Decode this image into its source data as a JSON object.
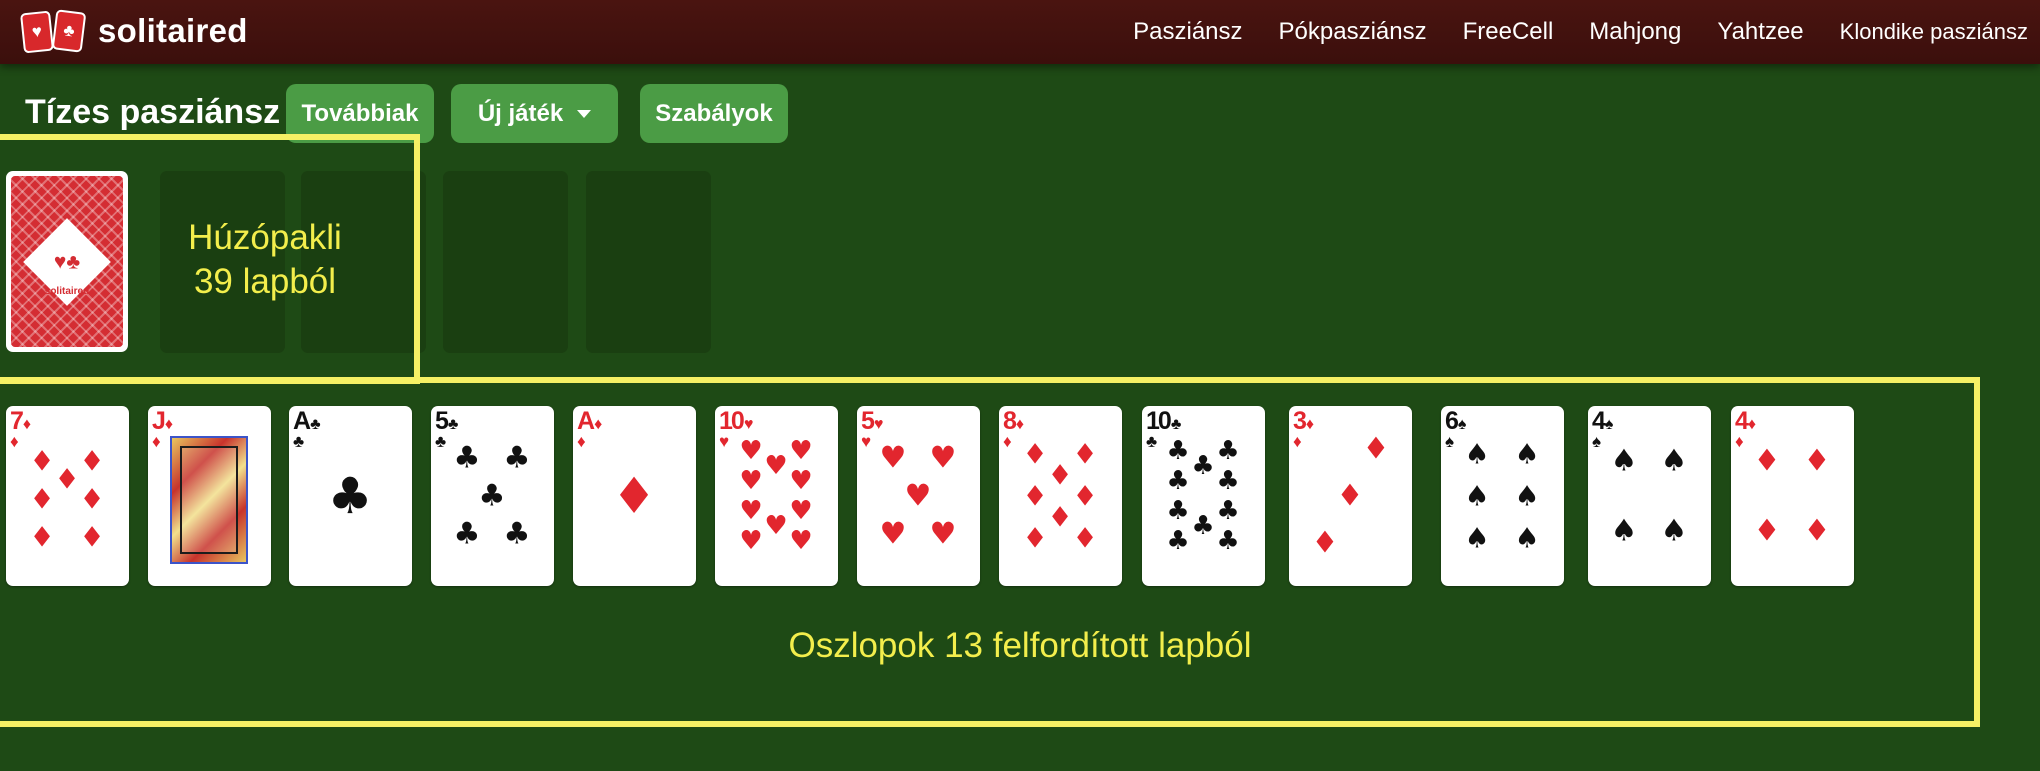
{
  "brand": {
    "name": "solitaired",
    "logo_suits": [
      "♥",
      "♣"
    ]
  },
  "nav": {
    "items": [
      "Pasziánsz",
      "Pókpasziánsz",
      "FreeCell",
      "Mahjong",
      "Yahtzee",
      "Klondike pasziánsz"
    ]
  },
  "toolbar": {
    "title": "Tízes pasziánsz",
    "more_label": "Továbbiak",
    "new_game_label": "Új játék",
    "rules_label": "Szabályok"
  },
  "stock": {
    "brand": "solitaired"
  },
  "annotations": {
    "stock_line1": "Húzópakli",
    "stock_line2": "39 lapból",
    "columns": "Oszlopok 13 felfordított lapból"
  },
  "colors": {
    "felt": "#1e4a15",
    "header": "#4a1410",
    "button": "#4b9c45",
    "highlight": "#f5f065",
    "red_suit": "#e2262e"
  },
  "cards": [
    {
      "rank": "7",
      "suit": "♦",
      "color": "red"
    },
    {
      "rank": "J",
      "suit": "♦",
      "color": "red",
      "face": true
    },
    {
      "rank": "A",
      "suit": "♣",
      "color": "black"
    },
    {
      "rank": "5",
      "suit": "♣",
      "color": "black"
    },
    {
      "rank": "A",
      "suit": "♦",
      "color": "red"
    },
    {
      "rank": "10",
      "suit": "♥",
      "color": "red"
    },
    {
      "rank": "5",
      "suit": "♥",
      "color": "red"
    },
    {
      "rank": "8",
      "suit": "♦",
      "color": "red"
    },
    {
      "rank": "10",
      "suit": "♣",
      "color": "black"
    },
    {
      "rank": "3",
      "suit": "♦",
      "color": "red"
    },
    {
      "rank": "6",
      "suit": "♠",
      "color": "black"
    },
    {
      "rank": "4",
      "suit": "♠",
      "color": "black"
    },
    {
      "rank": "4",
      "suit": "♦",
      "color": "red"
    }
  ]
}
